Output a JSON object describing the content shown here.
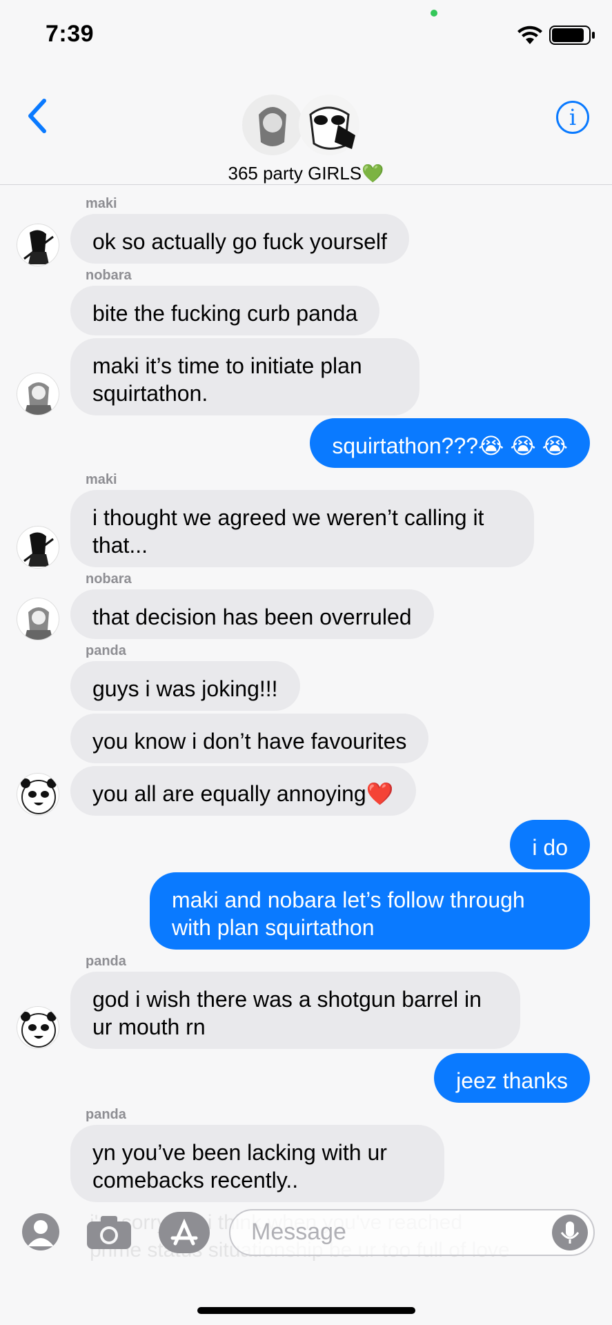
{
  "status_bar": {
    "time": "7:39"
  },
  "header": {
    "group_name": "365 party GIRLS",
    "heart": "💚",
    "info_label": "i"
  },
  "messages": [
    {
      "type": "in",
      "sender": "maki",
      "text": "ok so actually go fuck yourself",
      "avatar": "maki"
    },
    {
      "type": "in",
      "sender": "nobara",
      "text": "bite the fucking curb panda",
      "avatar": ""
    },
    {
      "type": "in",
      "sender": "",
      "text": "maki it’s time to initiate plan squirtathon.",
      "avatar": "nobara"
    },
    {
      "type": "out",
      "text": "squirtathon???😭 😭 😭"
    },
    {
      "type": "in",
      "sender": "maki",
      "text": "i thought we agreed we weren’t calling it that...",
      "avatar": "maki"
    },
    {
      "type": "in",
      "sender": "nobara",
      "text": "that decision has been overruled",
      "avatar": "nobara"
    },
    {
      "type": "in",
      "sender": "panda",
      "text": "guys i was joking!!!",
      "avatar": ""
    },
    {
      "type": "in",
      "sender": "",
      "text": "you know i don’t have favourites",
      "avatar": ""
    },
    {
      "type": "in",
      "sender": "",
      "text": "you all are equally annoying❤️",
      "avatar": "panda"
    },
    {
      "type": "out",
      "text": "i do"
    },
    {
      "type": "out",
      "text": "maki and nobara let’s follow through with plan squirtathon"
    },
    {
      "type": "in",
      "sender": "panda",
      "text": "god i wish there was a shotgun barrel in ur mouth rn",
      "avatar": "panda"
    },
    {
      "type": "out",
      "text": "jeez thanks"
    },
    {
      "type": "in",
      "sender": "panda",
      "text": "yn you’ve been lacking with ur comebacks recently..",
      "avatar": ""
    }
  ],
  "faded_message": "i'm sorry but i think when you've reached prime status situationship be ur too full of love",
  "input": {
    "placeholder": "Message"
  },
  "colors": {
    "accent": "#0a7aff",
    "incoming_bubble": "#e9e9ec",
    "sender_label": "#8e8e93"
  }
}
